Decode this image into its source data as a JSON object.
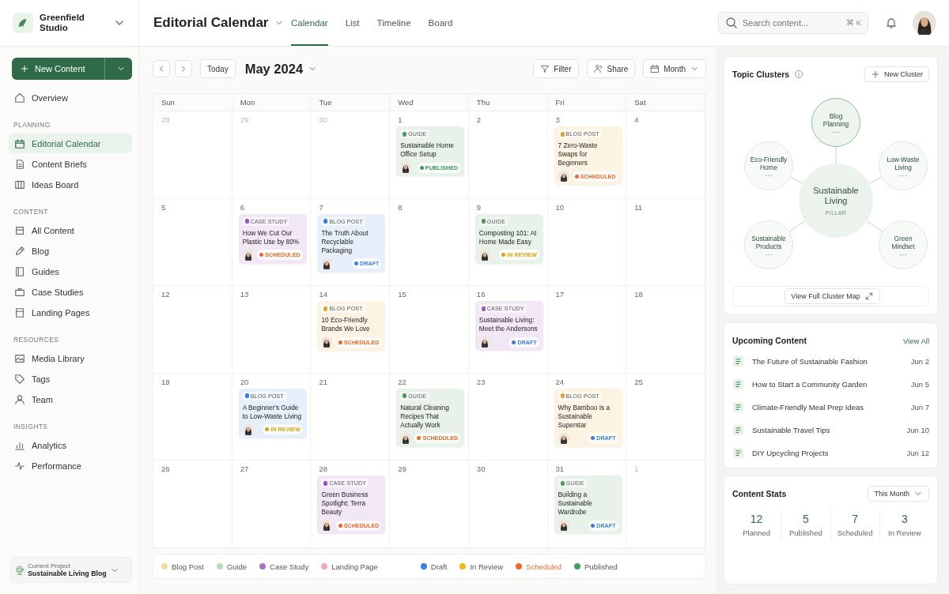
{
  "workspace": {
    "name": "Greenfield Studio"
  },
  "page_title": "Editorial Calendar",
  "view_tabs": [
    {
      "label": "Calendar",
      "selected": true
    },
    {
      "label": "List",
      "selected": false
    },
    {
      "label": "Timeline",
      "selected": false
    },
    {
      "label": "Board",
      "selected": false
    }
  ],
  "search": {
    "placeholder": "Search content...",
    "shortcut": "⌘ K"
  },
  "sidebar": {
    "new_button": "New Content",
    "sections": [
      {
        "items": [
          {
            "label": "Overview",
            "selected": false
          }
        ]
      },
      {
        "heading": "PLANNING",
        "items": [
          {
            "label": "Editorial Calendar",
            "selected": true
          },
          {
            "label": "Content Briefs",
            "selected": false
          },
          {
            "label": "Ideas Board",
            "selected": false
          }
        ]
      },
      {
        "heading": "CONTENT",
        "items": [
          {
            "label": "All Content",
            "selected": false
          },
          {
            "label": "Blog",
            "selected": false
          },
          {
            "label": "Guides",
            "selected": false
          },
          {
            "label": "Case Studies",
            "selected": false
          },
          {
            "label": "Landing Pages",
            "selected": false
          }
        ]
      },
      {
        "heading": "RESOURCES",
        "items": [
          {
            "label": "Media Library",
            "selected": false
          },
          {
            "label": "Tags",
            "selected": false
          },
          {
            "label": "Team",
            "selected": false
          }
        ]
      },
      {
        "heading": "INSIGHTS",
        "items": [
          {
            "label": "Analytics",
            "selected": false
          },
          {
            "label": "Performance",
            "selected": false
          }
        ]
      }
    ],
    "project": {
      "caption": "Current Project",
      "name": "Sustainable Living Blog"
    }
  },
  "toolbar": {
    "today": "Today",
    "month": "May 2024",
    "filter": "Filter",
    "share": "Share",
    "view": "Month"
  },
  "calendar": {
    "weekdays": [
      "Sun",
      "Mon",
      "Tue",
      "Wed",
      "Thu",
      "Fri",
      "Sat"
    ],
    "weeks": [
      [
        {
          "date": "28",
          "outside": true
        },
        {
          "date": "29",
          "outside": true
        },
        {
          "date": "30",
          "outside": true
        },
        {
          "date": "1",
          "outside": false,
          "card": {
            "tag": {
              "label": "GUIDE",
              "color": "#4f9a63"
            },
            "title": "Sustainable Home Office Setup",
            "status": {
              "label": "PUBLISHED",
              "color": "#3f9a5c"
            },
            "color": "#e8f2e9"
          }
        },
        {
          "date": "2",
          "outside": false
        },
        {
          "date": "3",
          "outside": false,
          "card": {
            "tag": {
              "label": "BLOG POST",
              "color": "#d6a53a"
            },
            "title": "7 Zero-Waste Swaps for Beginners",
            "status": {
              "label": "SCHEDULED",
              "color": "#e8692c"
            },
            "color": "#fcf3e2"
          }
        },
        {
          "date": "4",
          "outside": false
        }
      ],
      [
        {
          "date": "5",
          "outside": false
        },
        {
          "date": "6",
          "outside": false,
          "card": {
            "tag": {
              "label": "CASE STUDY",
              "color": "#9b55b8"
            },
            "title": "How We Cut Our Plastic Use by 80%",
            "status": {
              "label": "SCHEDULED",
              "color": "#e8692c"
            },
            "color": "#f2e7f5"
          }
        },
        {
          "date": "7",
          "outside": false,
          "card": {
            "tag": {
              "label": "BLOG POST",
              "color": "#3b7fd9"
            },
            "title": "The Truth About Recyclable Packaging",
            "status": {
              "label": "DRAFT",
              "color": "#3b7fd9"
            },
            "color": "#e7f0fa"
          }
        },
        {
          "date": "8",
          "outside": false
        },
        {
          "date": "9",
          "outside": false,
          "card": {
            "tag": {
              "label": "GUIDE",
              "color": "#4f9a63"
            },
            "title": "Composting 101: At Home Made Easy",
            "status": {
              "label": "IN REVIEW",
              "color": "#d9a412"
            },
            "color": "#e8f2e9"
          }
        },
        {
          "date": "10",
          "outside": false
        },
        {
          "date": "11",
          "outside": false
        }
      ],
      [
        {
          "date": "12",
          "outside": false
        },
        {
          "date": "13",
          "outside": false
        },
        {
          "date": "14",
          "outside": false,
          "card": {
            "tag": {
              "label": "BLOG POST",
              "color": "#d6a53a"
            },
            "title": "10 Eco-Friendly Brands We Love",
            "status": {
              "label": "SCHEDULED",
              "color": "#e8692c"
            },
            "color": "#fcf3e2"
          }
        },
        {
          "date": "15",
          "outside": false
        },
        {
          "date": "16",
          "outside": false,
          "card": {
            "tag": {
              "label": "CASE STUDY",
              "color": "#9b55b8"
            },
            "title": "Sustainable Living: Meet the Andersons",
            "status": {
              "label": "DRAFT",
              "color": "#3b7fd9"
            },
            "color": "#f2e7f5"
          }
        },
        {
          "date": "17",
          "outside": false
        },
        {
          "date": "18",
          "outside": false
        }
      ],
      [
        {
          "date": "19",
          "outside": false
        },
        {
          "date": "20",
          "outside": false,
          "card": {
            "tag": {
              "label": "BLOG POST",
              "color": "#3b7fd9"
            },
            "title": "A Beginner's Guide to Low-Waste Living",
            "status": {
              "label": "IN REVIEW",
              "color": "#d9a412"
            },
            "color": "#e7f0fa"
          }
        },
        {
          "date": "21",
          "outside": false
        },
        {
          "date": "22",
          "outside": false,
          "card": {
            "tag": {
              "label": "GUIDE",
              "color": "#4f9a63"
            },
            "title": "Natural Cleaning Recipes That Actually Work",
            "status": {
              "label": "SCHEDULED",
              "color": "#e8692c"
            },
            "color": "#e8f2e9"
          }
        },
        {
          "date": "23",
          "outside": false
        },
        {
          "date": "24",
          "outside": false,
          "card": {
            "tag": {
              "label": "BLOG POST",
              "color": "#d6a53a"
            },
            "title": "Why Bamboo Is a Sustainable Superstar",
            "status": {
              "label": "DRAFT",
              "color": "#3b7fd9"
            },
            "color": "#fcf3e2"
          }
        },
        {
          "date": "25",
          "outside": false
        }
      ],
      [
        {
          "date": "26",
          "outside": false
        },
        {
          "date": "27",
          "outside": false
        },
        {
          "date": "28",
          "outside": false,
          "card": {
            "tag": {
              "label": "CASE STUDY",
              "color": "#9b55b8"
            },
            "title": "Green Business Spotlight: Terra Beauty",
            "status": {
              "label": "SCHEDULED",
              "color": "#e8692c"
            },
            "color": "#f2e7f5"
          }
        },
        {
          "date": "29",
          "outside": false
        },
        {
          "date": "30",
          "outside": false
        },
        {
          "date": "31",
          "outside": false,
          "card": {
            "tag": {
              "label": "GUIDE",
              "color": "#4f9a63"
            },
            "title": "Building a Sustainable Wardrobe",
            "status": {
              "label": "DRAFT",
              "color": "#3b7fd9"
            },
            "color": "#e8f2e9"
          }
        },
        {
          "date": "1",
          "outside": true
        }
      ]
    ]
  },
  "legend": {
    "types": [
      {
        "label": "Blog Post",
        "color": "#f5d9a0"
      },
      {
        "label": "Guide",
        "color": "#b9dcc0"
      },
      {
        "label": "Case Study",
        "color": "#b06cc9"
      },
      {
        "label": "Landing Page",
        "color": "#f3a6be"
      }
    ],
    "statuses": [
      {
        "label": "Draft",
        "color": "#3b82e0",
        "highlight": false
      },
      {
        "label": "In Review",
        "color": "#f0b819",
        "highlight": false
      },
      {
        "label": "Scheduled",
        "color": "#ee6a2c",
        "highlight": true
      },
      {
        "label": "Published",
        "color": "#4a9a63",
        "highlight": false
      }
    ]
  },
  "topic_clusters": {
    "title": "Topic Clusters",
    "new_button": "New Cluster",
    "pillar": {
      "label": "Sustainable Living",
      "tag": "PILLAR"
    },
    "topics": [
      {
        "label": "Blog Planning",
        "focused": true
      },
      {
        "label": "Eco-Friendly Home",
        "focused": false
      },
      {
        "label": "Low-Waste Living",
        "focused": false
      },
      {
        "label": "Sustainable Products",
        "focused": false
      },
      {
        "label": "Green Mindset",
        "focused": false
      }
    ],
    "map_button": "View Full Cluster Map"
  },
  "upcoming": {
    "title": "Upcoming Content",
    "link": "View All",
    "items": [
      {
        "title": "The Future of Sustainable Fashion",
        "date": "Jun 2"
      },
      {
        "title": "How to Start a Community Garden",
        "date": "Jun 5"
      },
      {
        "title": "Climate-Friendly Meal Prep Ideas",
        "date": "Jun 7"
      },
      {
        "title": "Sustainable Travel Tips",
        "date": "Jun 10"
      },
      {
        "title": "DIY Upcycling Projects",
        "date": "Jun 12"
      }
    ]
  },
  "stats": {
    "title": "Content Stats",
    "period": "This Month",
    "items": [
      {
        "value": "12",
        "label": "Planned"
      },
      {
        "value": "5",
        "label": "Published"
      },
      {
        "value": "7",
        "label": "Scheduled"
      },
      {
        "value": "3",
        "label": "In Review"
      }
    ]
  }
}
